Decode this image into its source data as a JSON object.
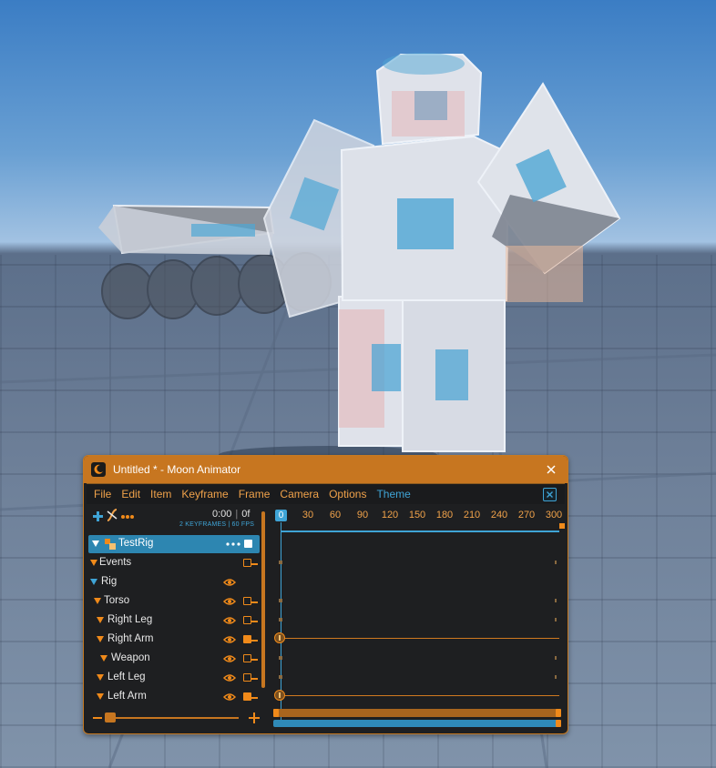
{
  "window": {
    "title": "Untitled * - Moon Animator"
  },
  "menu": [
    "File",
    "Edit",
    "Item",
    "Keyframe",
    "Frame",
    "Camera",
    "Options",
    "Theme"
  ],
  "toolbar": {
    "time": "0:00",
    "frame": "0f",
    "keyframe_info": "2 KEYFRAMES | 60 FPS"
  },
  "ruler": [
    "0",
    "30",
    "60",
    "90",
    "120",
    "150",
    "180",
    "210",
    "240",
    "270",
    "300"
  ],
  "tree": [
    {
      "label": "TestRig"
    },
    {
      "label": "Events"
    },
    {
      "label": "Rig"
    },
    {
      "label": "Torso"
    },
    {
      "label": "Right Leg"
    },
    {
      "label": "Right Arm"
    },
    {
      "label": "Weapon"
    },
    {
      "label": "Left Leg"
    },
    {
      "label": "Left Arm"
    }
  ],
  "colors": {
    "accent_orange": "#c77620",
    "accent_blue": "#3fa4d6",
    "panel_bg": "#1e1f21"
  },
  "icons": {
    "app": "moon-icon",
    "close": "close-icon",
    "add": "plus-icon",
    "easing": "easing-icon",
    "more": "more-dots-icon",
    "visibility": "eye-icon"
  }
}
